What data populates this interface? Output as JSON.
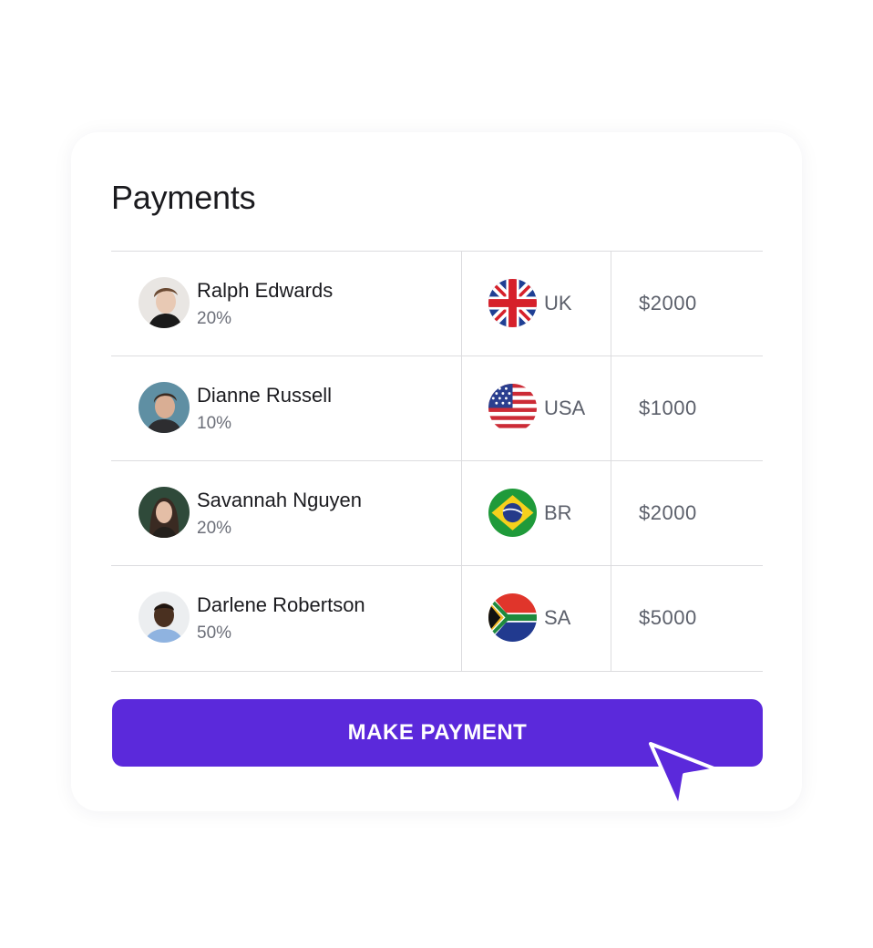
{
  "header": {
    "title": "Payments"
  },
  "payments": [
    {
      "name": "Ralph Edwards",
      "percent": "20%",
      "country": "UK",
      "flag": "uk-flag-icon",
      "amount": "$2000",
      "avatar": "avatar-ralph"
    },
    {
      "name": "Dianne Russell",
      "percent": "10%",
      "country": "USA",
      "flag": "usa-flag-icon",
      "amount": "$1000",
      "avatar": "avatar-dianne"
    },
    {
      "name": "Savannah Nguyen",
      "percent": "20%",
      "country": "BR",
      "flag": "brazil-flag-icon",
      "amount": "$2000",
      "avatar": "avatar-savannah"
    },
    {
      "name": "Darlene Robertson",
      "percent": "50%",
      "country": "SA",
      "flag": "south-africa-flag-icon",
      "amount": "$5000",
      "avatar": "avatar-darlene"
    }
  ],
  "actions": {
    "make_payment_label": "MAKE PAYMENT"
  },
  "colors": {
    "accent": "#5b29db",
    "text": "#1b1b1f",
    "muted": "#6b6e78",
    "border": "#dcdcdf"
  },
  "cursor": {
    "icon": "pointer-cursor-icon"
  }
}
